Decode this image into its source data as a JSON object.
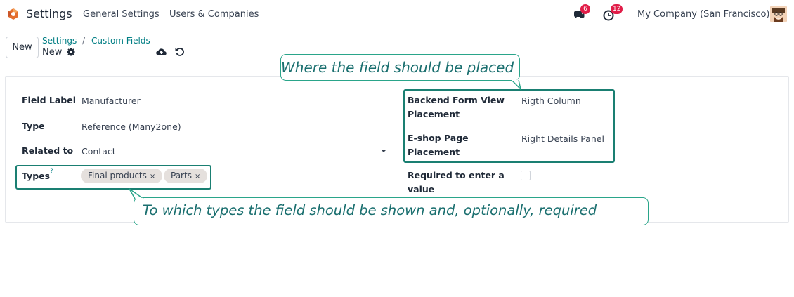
{
  "navbar": {
    "app_name": "Settings",
    "menu": [
      "General Settings",
      "Users & Companies"
    ],
    "chat_badge": "6",
    "activity_badge": "12",
    "company": "My Company (San Francisco)",
    "icons": [
      "odoo-logo-icon",
      "chat-icon",
      "clock-icon",
      "avatar"
    ]
  },
  "control_panel": {
    "new_label": "New",
    "breadcrumb": [
      "Settings",
      "Custom Fields"
    ],
    "separator": "/",
    "record_name": "New",
    "icons": [
      "gear-icon",
      "cloud-upload-icon",
      "undo-icon"
    ]
  },
  "form": {
    "left": {
      "field_label_label": "Field Label",
      "field_label_value": "Manufacturer",
      "type_label": "Type",
      "type_value": "Reference (Many2one)",
      "related_label": "Related to",
      "related_value": "Contact",
      "types_label": "Types",
      "types_help": "?",
      "types_tags": [
        "Final products",
        "Parts"
      ],
      "tag_remove": "×"
    },
    "right": {
      "backend_label_1": "Backend Form View",
      "backend_label_2": "Placement",
      "backend_value": "Rigth Column",
      "eshop_label_1": "E-shop Page",
      "eshop_label_2": "Placement",
      "eshop_value": "Right Details Panel",
      "required_label_1": "Required to enter a",
      "required_label_2": "value",
      "required_checked": false
    }
  },
  "annotations": {
    "top": "Where the field should be placed",
    "bottom": "To which types the field should be shown and, optionally, required"
  },
  "colors": {
    "link": "#017e84",
    "annotation": "#1a7f72",
    "badge": "#e11d48",
    "tag_bg": "#e5e0dd"
  }
}
